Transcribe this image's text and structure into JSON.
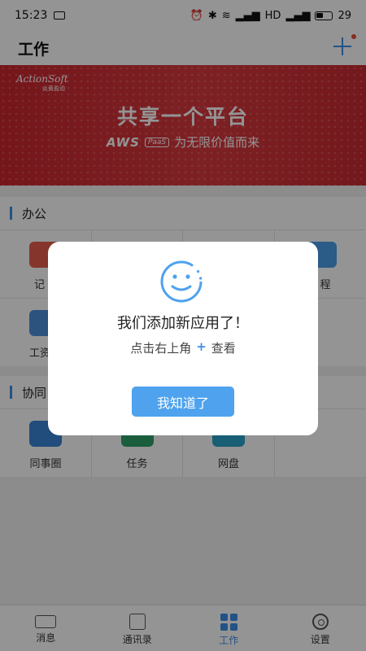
{
  "status_bar": {
    "time": "15:23",
    "signal_label": "HD",
    "battery_level": "29"
  },
  "header": {
    "title": "工作",
    "add_icon": "plus-icon"
  },
  "banner": {
    "logo_text": "ActionSoft",
    "logo_sub": "炎黄盈动",
    "headline": "共享一个平台",
    "brand": "AWS",
    "badge": "PaaS",
    "tagline": "为无限价值而来",
    "colors": {
      "background": "#c9262e"
    }
  },
  "sections": {
    "office": {
      "title": "办公",
      "row1": [
        "记",
        "",
        "",
        "程"
      ],
      "row2": [
        "工资",
        "",
        "",
        ""
      ]
    },
    "collab": {
      "title": "协同",
      "items": [
        "同事圈",
        "任务",
        "网盘"
      ]
    }
  },
  "dialog": {
    "title": "我们添加新应用了！",
    "hint_prefix": "点击右上角",
    "hint_symbol": "+",
    "hint_suffix": "查看",
    "confirm_label": "我知道了",
    "icon": "smile-icon"
  },
  "bottom_nav": {
    "items": [
      {
        "label": "消息",
        "icon": "message-icon"
      },
      {
        "label": "通讯录",
        "icon": "contacts-icon"
      },
      {
        "label": "工作",
        "icon": "apps-grid-icon"
      },
      {
        "label": "设置",
        "icon": "gear-icon"
      }
    ],
    "active": "工作"
  },
  "colors": {
    "accent": "#3d8ee8",
    "overlay": "rgba(0,0,0,0.42)"
  }
}
